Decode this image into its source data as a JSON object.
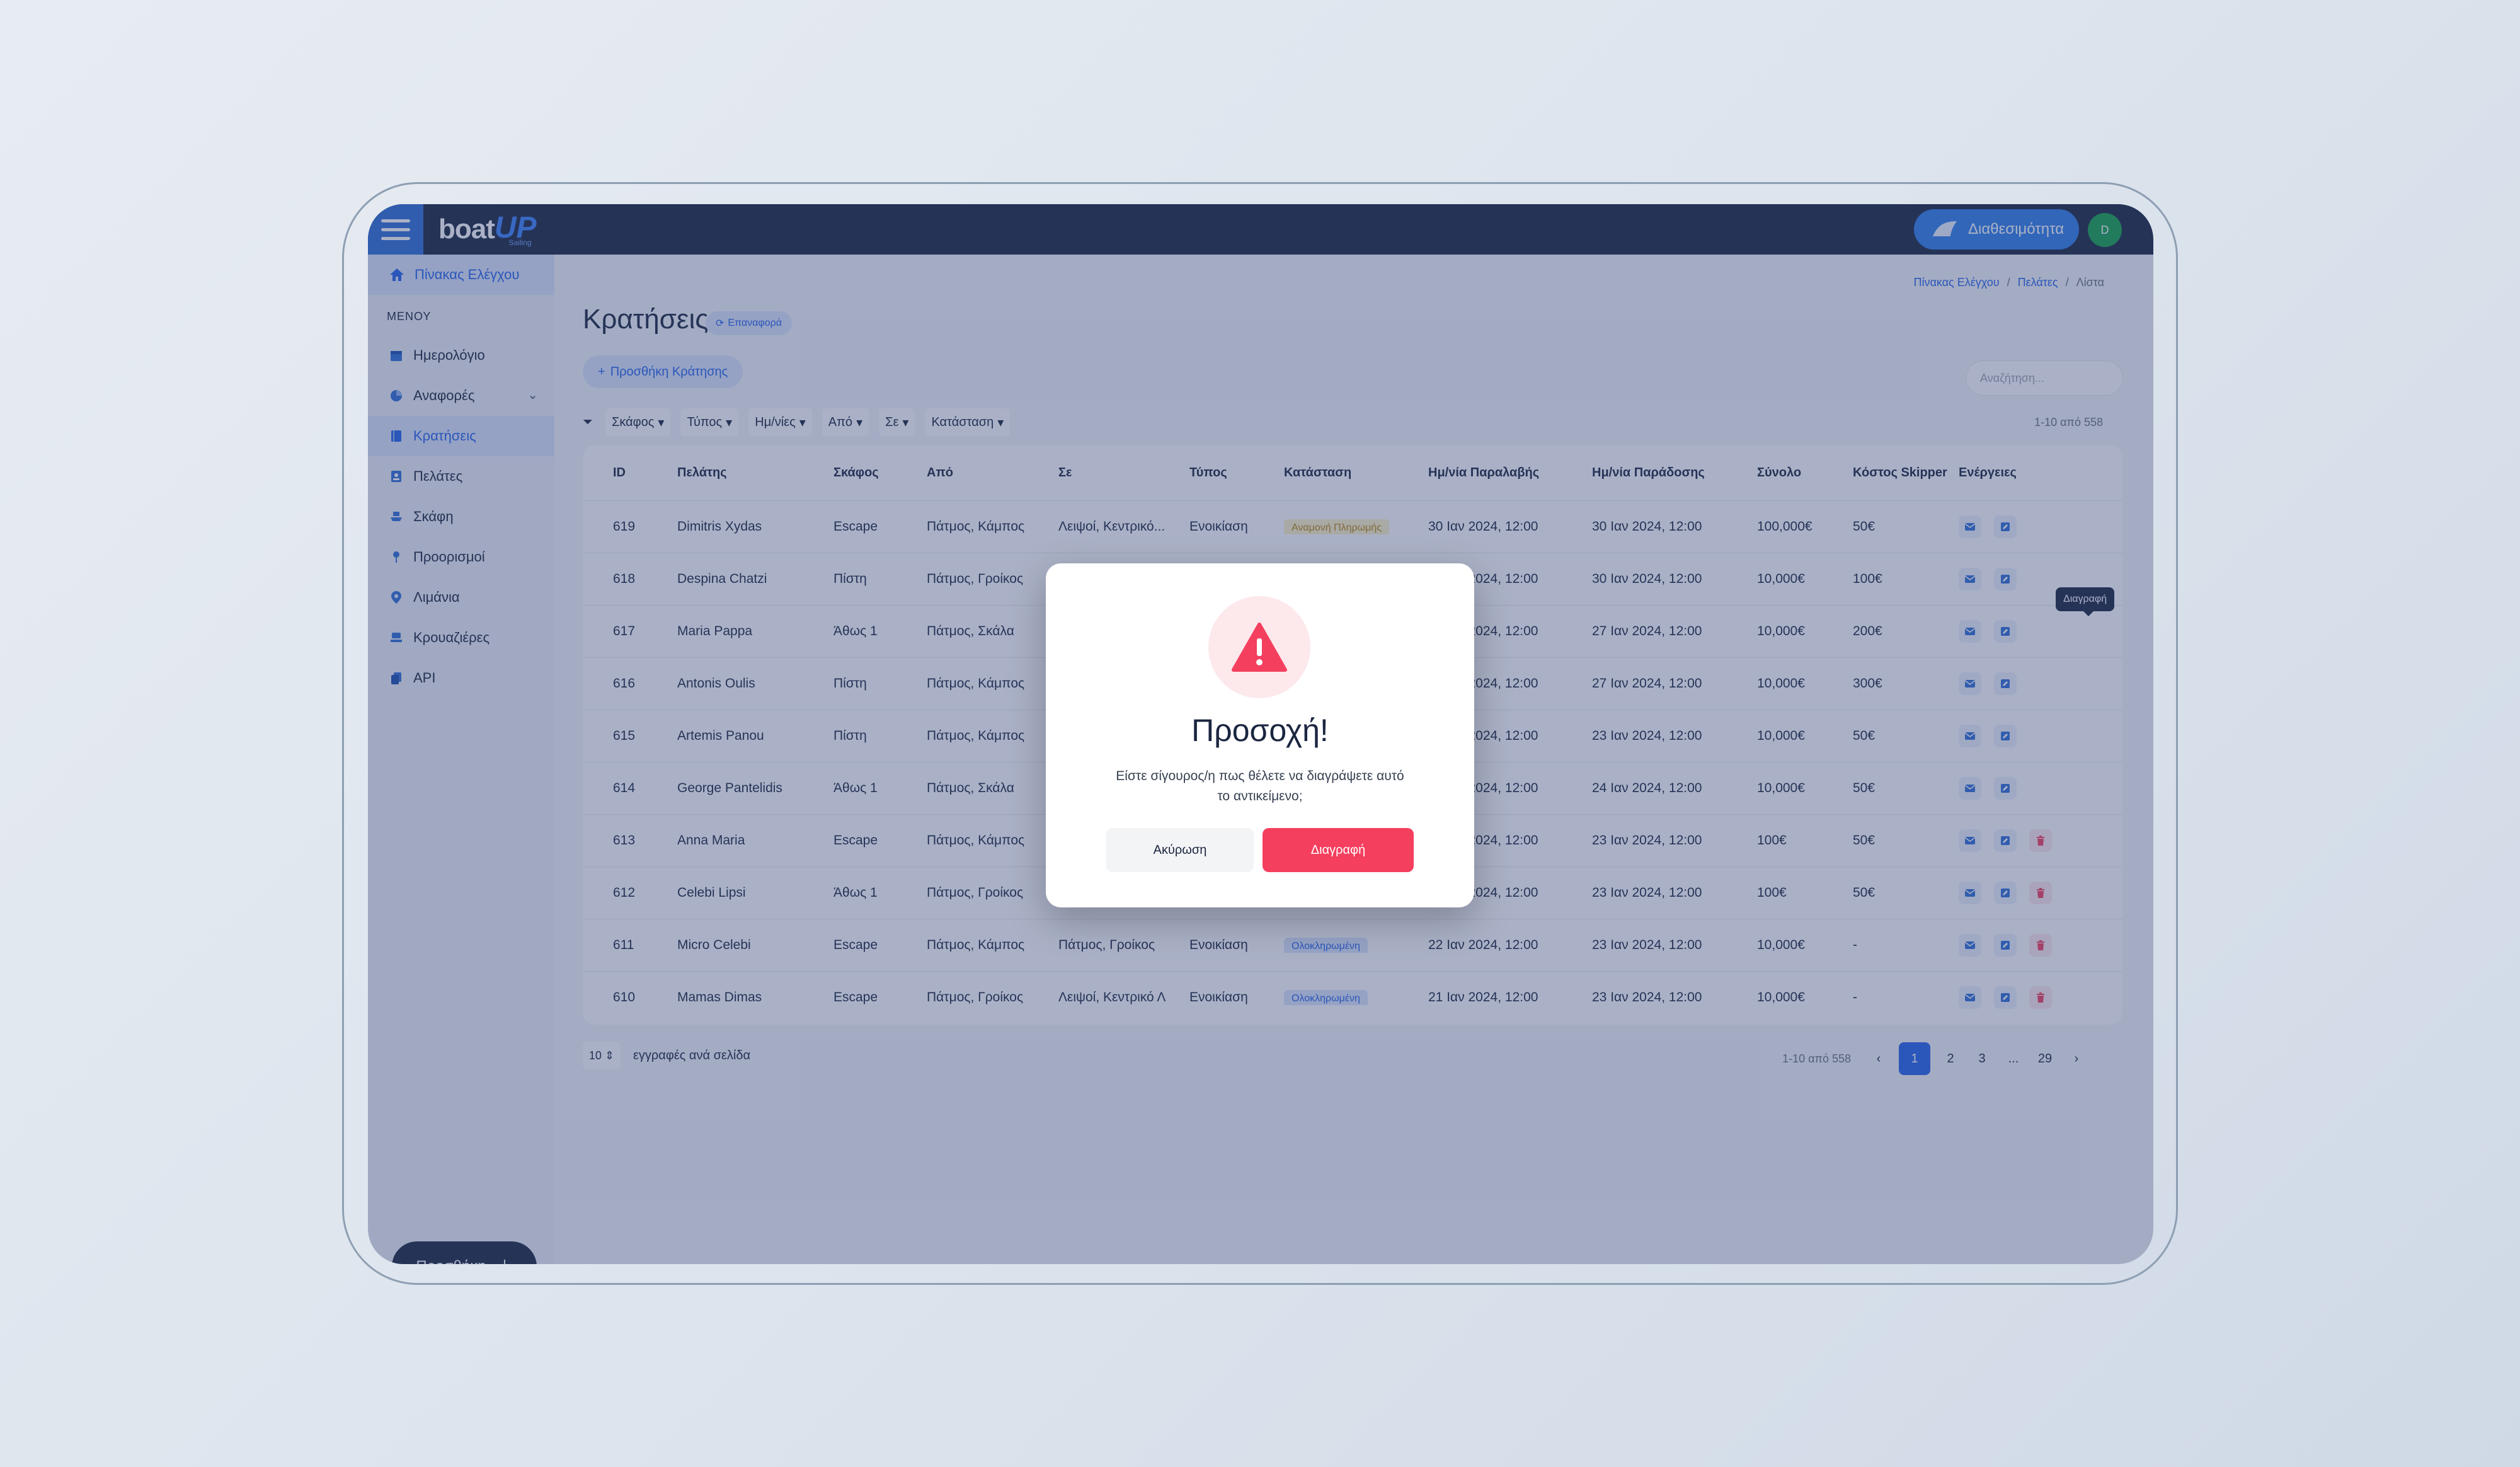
{
  "app": {
    "logo_main": "boat",
    "logo_accent": "UP",
    "logo_sub": "Sailing"
  },
  "topbar": {
    "availability_label": "Διαθεσιμότητα",
    "avatar_initial": "D"
  },
  "sidebar": {
    "home_label": "Πίνακας Ελέγχου",
    "section_label": "ΜΕΝΟΥ",
    "items": [
      {
        "label": "Ημερολόγιο",
        "icon": "calendar-icon"
      },
      {
        "label": "Αναφορές",
        "icon": "pie-chart-icon"
      },
      {
        "label": "Κρατήσεις",
        "icon": "book-icon"
      },
      {
        "label": "Πελάτες",
        "icon": "contact-icon"
      },
      {
        "label": "Σκάφη",
        "icon": "ship-icon"
      },
      {
        "label": "Προορισμοί",
        "icon": "pin-icon"
      },
      {
        "label": "Λιμάνια",
        "icon": "map-marker-icon"
      },
      {
        "label": "Κρουαζιέρες",
        "icon": "ferry-icon"
      },
      {
        "label": "API",
        "icon": "copy-icon"
      }
    ],
    "add_button_label": "Προσθήκη"
  },
  "breadcrumb": {
    "items": [
      "Πίνακας Ελέγχου",
      "Πελάτες",
      "Λίστα"
    ],
    "separator": "/"
  },
  "page": {
    "title": "Κρατήσεις",
    "reload_label": "Επαναφορά",
    "add_booking_label": "Προσθήκη Κράτησης",
    "search_placeholder": "Αναζήτηση...",
    "filters": [
      "Σκάφος",
      "Τύπος",
      "Ημ/νίες",
      "Από",
      "Σε",
      "Κατάσταση"
    ],
    "rows_info": "1-10 από 558"
  },
  "table": {
    "headers": [
      "ID",
      "Πελάτης",
      "Σκάφος",
      "Από",
      "Σε",
      "Τύπος",
      "Κατάσταση",
      "Ημ/νία Παραλαβής",
      "Ημ/νία Παράδοσης",
      "Σύνολο",
      "Κόστος Skipper",
      "Ενέργειες"
    ],
    "rows": [
      {
        "id": "619",
        "customer": "Dimitris Xydas",
        "boat": "Escape",
        "from": "Πάτμος, Κάμπος",
        "to": "Λειψοί, Κεντρικό...",
        "type": "Ενοικίαση",
        "status": "Αναμονή Πληρωμής",
        "pickup": "30 Ιαν 2024, 12:00",
        "dropoff": "30 Ιαν 2024, 12:00",
        "total": "100,000€",
        "skipper": "50€"
      },
      {
        "id": "618",
        "customer": "Despina Chatzi",
        "boat": "Πίστη",
        "from": "Πάτμος, Γροίκος",
        "to": "",
        "type": "",
        "status": "",
        "pickup": "30 Ιαν 2024, 12:00",
        "dropoff": "30 Ιαν 2024, 12:00",
        "total": "10,000€",
        "skipper": "100€"
      },
      {
        "id": "617",
        "customer": "Maria Pappa",
        "boat": "Άθως 1",
        "from": "Πάτμος, Σκάλα",
        "to": "",
        "type": "",
        "status": "",
        "pickup": "27 Ιαν 2024, 12:00",
        "dropoff": "27 Ιαν 2024, 12:00",
        "total": "10,000€",
        "skipper": "200€"
      },
      {
        "id": "616",
        "customer": "Antonis Oulis",
        "boat": "Πίστη",
        "from": "Πάτμος, Κάμπος",
        "to": "",
        "type": "",
        "status": "",
        "pickup": "27 Ιαν 2024, 12:00",
        "dropoff": "27 Ιαν 2024, 12:00",
        "total": "10,000€",
        "skipper": "300€"
      },
      {
        "id": "615",
        "customer": "Artemis Panou",
        "boat": "Πίστη",
        "from": "Πάτμος, Κάμπος",
        "to": "",
        "type": "",
        "status": "",
        "pickup": "23 Ιαν 2024, 12:00",
        "dropoff": "23 Ιαν 2024, 12:00",
        "total": "10,000€",
        "skipper": "50€"
      },
      {
        "id": "614",
        "customer": "George Pantelidis",
        "boat": "Άθως 1",
        "from": "Πάτμος, Σκάλα",
        "to": "",
        "type": "",
        "status": "",
        "pickup": "24 Ιαν 2024, 12:00",
        "dropoff": "24 Ιαν 2024, 12:00",
        "total": "10,000€",
        "skipper": "50€"
      },
      {
        "id": "613",
        "customer": "Anna Maria",
        "boat": "Escape",
        "from": "Πάτμος, Κάμπος",
        "to": "",
        "type": "",
        "status": "",
        "pickup": "23 Ιαν 2024, 12:00",
        "dropoff": "23 Ιαν 2024, 12:00",
        "total": "100€",
        "skipper": "50€"
      },
      {
        "id": "612",
        "customer": "Celebi Lipsi",
        "boat": "Άθως 1",
        "from": "Πάτμος, Γροίκος",
        "to": "",
        "type": "",
        "status": "",
        "pickup": "23 Ιαν 2024, 12:00",
        "dropoff": "23 Ιαν 2024, 12:00",
        "total": "100€",
        "skipper": "50€"
      },
      {
        "id": "611",
        "customer": "Micro Celebi",
        "boat": "Escape",
        "from": "Πάτμος, Κάμπος",
        "to": "Πάτμος, Γροίκος",
        "type": "Ενοικίαση",
        "status": "Ολοκληρωμένη",
        "pickup": "22 Ιαν 2024, 12:00",
        "dropoff": "23 Ιαν 2024, 12:00",
        "total": "10,000€",
        "skipper": "-"
      },
      {
        "id": "610",
        "customer": "Mamas Dimas",
        "boat": "Escape",
        "from": "Πάτμος, Γροίκος",
        "to": "Λειψοί, Κεντρικό Λ",
        "type": "Ενοικίαση",
        "status": "Ολοκληρωμένη",
        "pickup": "21 Ιαν 2024, 12:00",
        "dropoff": "23 Ιαν 2024, 12:00",
        "total": "10,000€",
        "skipper": "-"
      }
    ],
    "tooltip": "Διαγραφή"
  },
  "pagination": {
    "per_page": "10",
    "per_page_label": "εγγραφές ανά σελίδα",
    "info": "1-10 από 558",
    "prev": "‹",
    "pages": [
      "1",
      "2",
      "3",
      "...",
      "29"
    ],
    "next": "›"
  },
  "dialog": {
    "title": "Προσοχή!",
    "message": "Είστε σίγουρος/η πως θέλετε να διαγράψετε αυτό το αντικείμενο;",
    "cancel_label": "Ακύρωση",
    "confirm_label": "Διαγραφή"
  },
  "colors": {
    "navy": "#1b2640",
    "primary": "#2563eb",
    "danger": "#f43f5e",
    "success": "#16a34a"
  }
}
